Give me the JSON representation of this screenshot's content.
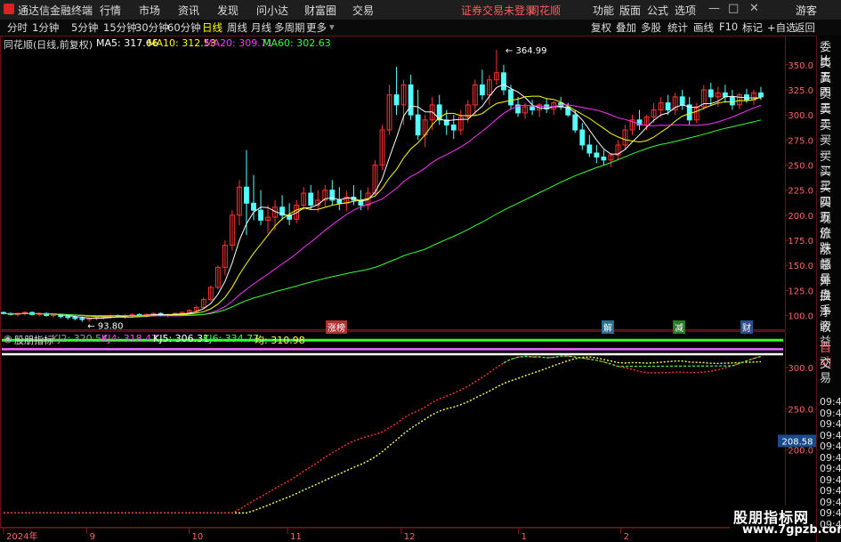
{
  "app": {
    "title": "通达信金融终端"
  },
  "menu": [
    "行情",
    "市场",
    "资讯",
    "发现",
    "问小达",
    "财富圈",
    "交易"
  ],
  "warning": {
    "text": "证券交易未登录",
    "brand": "同花顺"
  },
  "right_menu": [
    "功能",
    "版面",
    "公式",
    "选项"
  ],
  "guest": "游客",
  "toolbar": {
    "periods": [
      "分时",
      "1分钟",
      "5分钟",
      "15分钟",
      "30分钟",
      "60分钟",
      "日线",
      "周线",
      "月线",
      "多周期",
      "更多"
    ],
    "active": "日线",
    "right": [
      "复权",
      "叠加",
      "多股",
      "统计",
      "画线",
      "F10",
      "标记",
      "+自选",
      "返回"
    ]
  },
  "legend_main": {
    "name": "同花顺(日线,前复权)",
    "items": [
      {
        "label": "MA5: 317.66",
        "color": "#ffffff"
      },
      {
        "label": "MA10: 312.53",
        "color": "#ffff00"
      },
      {
        "label": "MA20: 309.71",
        "color": "#ff33ff"
      },
      {
        "label": "MA60: 302.63",
        "color": "#33ff33"
      }
    ]
  },
  "legend_sub": {
    "name": "股朋指标",
    "items": [
      {
        "label": "KJ2: 320.54",
        "color": "#999999"
      },
      {
        "label": "KJ4: 318.47",
        "color": "#ff44ff"
      },
      {
        "label": "KJ5: 306.31",
        "color": "#ffffff"
      },
      {
        "label": "KJ6: 334.77",
        "color": "#33ff33"
      },
      {
        "label": "均: 310.98",
        "color": "#ffff66"
      }
    ]
  },
  "right_panel": {
    "items": [
      "委比",
      "卖五",
      "卖四",
      "卖三",
      "卖二",
      "卖一",
      "买一",
      "买二",
      "买三",
      "买四",
      "买五",
      "现价",
      "涨跌",
      "涨幅",
      "总量",
      "外盘",
      "换手",
      "净资",
      "收益"
    ],
    "auto": "自动",
    "trade": "交易",
    "times": [
      "09:47",
      "09:47",
      "09:47",
      "09:47",
      "09:47",
      "09:47",
      "09:47",
      "09:47",
      "09:47",
      "09:47",
      "09:47",
      "09:47"
    ]
  },
  "markers": [
    {
      "label": "涨榜",
      "color": "#cc3333"
    },
    {
      "label": "解",
      "color": "#3399cc"
    },
    {
      "label": "减",
      "color": "#33aa33"
    },
    {
      "label": "财",
      "color": "#3366cc"
    }
  ],
  "watermark": {
    "line1": "股朋指标网",
    "line2": "www.7gpzb.com"
  },
  "current_value": "208.58",
  "chart_data": [
    {
      "type": "candlestick",
      "title": "同花顺(日线,前复权)",
      "y_ticks": [
        100,
        125,
        150,
        175,
        200,
        225,
        250,
        275,
        300,
        325,
        350
      ],
      "ylim": [
        88,
        372
      ],
      "x_labels": [
        "2024年",
        "9",
        "10",
        "11",
        "12",
        "1",
        "2"
      ],
      "annotations": [
        {
          "text": "364.99"
        },
        {
          "text": "93.80"
        }
      ],
      "candles": [
        [
          103,
          104,
          101,
          102
        ],
        [
          102,
          103,
          100,
          101
        ],
        [
          101,
          103,
          99,
          102
        ],
        [
          102,
          104,
          100,
          103
        ],
        [
          103,
          104,
          100,
          101
        ],
        [
          101,
          103,
          99,
          102
        ],
        [
          102,
          103,
          99,
          100
        ],
        [
          100,
          102,
          98,
          101
        ],
        [
          101,
          102,
          97,
          99
        ],
        [
          99,
          101,
          96,
          98
        ],
        [
          98,
          100,
          95,
          97
        ],
        [
          97,
          99,
          93.8,
          96
        ],
        [
          96,
          98,
          94,
          97
        ],
        [
          97,
          99,
          95,
          98
        ],
        [
          98,
          100,
          96,
          99
        ],
        [
          99,
          101,
          97,
          100
        ],
        [
          100,
          101,
          98,
          99
        ],
        [
          99,
          101,
          97,
          100
        ],
        [
          100,
          102,
          98,
          101
        ],
        [
          101,
          102,
          99,
          100
        ],
        [
          100,
          102,
          98,
          101
        ],
        [
          101,
          103,
          99,
          102
        ],
        [
          102,
          103,
          99,
          100
        ],
        [
          100,
          102,
          98,
          101
        ],
        [
          101,
          103,
          100,
          102
        ],
        [
          102,
          104,
          100,
          103
        ],
        [
          103,
          106,
          101,
          105
        ],
        [
          105,
          110,
          103,
          108
        ],
        [
          108,
          118,
          106,
          116
        ],
        [
          116,
          130,
          114,
          128
        ],
        [
          128,
          150,
          126,
          148
        ],
        [
          148,
          175,
          140,
          170
        ],
        [
          170,
          205,
          165,
          200
        ],
        [
          200,
          235,
          190,
          228
        ],
        [
          228,
          265,
          180,
          212
        ],
        [
          212,
          240,
          195,
          205
        ],
        [
          205,
          225,
          190,
          195
        ],
        [
          195,
          210,
          182,
          198
        ],
        [
          198,
          215,
          185,
          208
        ],
        [
          208,
          220,
          195,
          200
        ],
        [
          200,
          212,
          190,
          196
        ],
        [
          196,
          215,
          192,
          210
        ],
        [
          210,
          228,
          205,
          222
        ],
        [
          222,
          230,
          205,
          210
        ],
        [
          210,
          225,
          203,
          215
        ],
        [
          215,
          230,
          208,
          225
        ],
        [
          225,
          235,
          210,
          215
        ],
        [
          215,
          228,
          205,
          212
        ],
        [
          212,
          224,
          204,
          218
        ],
        [
          218,
          230,
          210,
          215
        ],
        [
          215,
          225,
          205,
          210
        ],
        [
          210,
          228,
          205,
          222
        ],
        [
          222,
          255,
          220,
          250
        ],
        [
          250,
          290,
          245,
          285
        ],
        [
          285,
          330,
          280,
          320
        ],
        [
          320,
          348,
          300,
          310
        ],
        [
          310,
          335,
          290,
          330
        ],
        [
          330,
          340,
          295,
          300
        ],
        [
          300,
          325,
          275,
          280
        ],
        [
          280,
          300,
          268,
          295
        ],
        [
          295,
          318,
          285,
          310
        ],
        [
          310,
          320,
          290,
          295
        ],
        [
          295,
          305,
          280,
          290
        ],
        [
          290,
          300,
          276,
          285
        ],
        [
          285,
          305,
          280,
          298
        ],
        [
          298,
          315,
          292,
          310
        ],
        [
          310,
          335,
          300,
          330
        ],
        [
          330,
          345,
          315,
          320
        ],
        [
          320,
          340,
          310,
          335
        ],
        [
          335,
          365,
          330,
          342
        ],
        [
          342,
          350,
          320,
          325
        ],
        [
          325,
          330,
          305,
          310
        ],
        [
          310,
          318,
          298,
          302
        ],
        [
          302,
          312,
          296,
          308
        ],
        [
          308,
          315,
          300,
          305
        ],
        [
          305,
          312,
          298,
          310
        ],
        [
          310,
          316,
          302,
          306
        ],
        [
          306,
          314,
          300,
          312
        ],
        [
          312,
          318,
          305,
          308
        ],
        [
          308,
          312,
          298,
          300
        ],
        [
          300,
          305,
          282,
          285
        ],
        [
          285,
          292,
          265,
          270
        ],
        [
          270,
          280,
          258,
          262
        ],
        [
          262,
          270,
          252,
          258
        ],
        [
          258,
          265,
          250,
          255
        ],
        [
          255,
          262,
          248,
          260
        ],
        [
          260,
          275,
          255,
          270
        ],
        [
          270,
          290,
          265,
          285
        ],
        [
          285,
          300,
          280,
          295
        ],
        [
          295,
          305,
          285,
          290
        ],
        [
          290,
          300,
          285,
          298
        ],
        [
          298,
          312,
          292,
          305
        ],
        [
          305,
          318,
          298,
          312
        ],
        [
          312,
          320,
          300,
          305
        ],
        [
          305,
          322,
          300,
          318
        ],
        [
          318,
          325,
          305,
          310
        ],
        [
          310,
          318,
          290,
          295
        ],
        [
          295,
          312,
          292,
          308
        ],
        [
          308,
          330,
          305,
          325
        ],
        [
          325,
          332,
          310,
          318
        ],
        [
          318,
          328,
          308,
          322
        ],
        [
          322,
          330,
          312,
          318
        ],
        [
          318,
          325,
          305,
          310
        ],
        [
          310,
          322,
          306,
          320
        ],
        [
          320,
          326,
          312,
          315
        ],
        [
          315,
          325,
          310,
          322
        ],
        [
          322,
          328,
          315,
          318
        ]
      ],
      "series": [
        {
          "name": "MA5",
          "color": "#ffffff"
        },
        {
          "name": "MA10",
          "color": "#ffff00"
        },
        {
          "name": "MA20",
          "color": "#ff33ff"
        },
        {
          "name": "MA60",
          "color": "#33ff33"
        }
      ]
    },
    {
      "type": "line",
      "title": "股朋指标",
      "y_ticks": [
        200,
        250,
        300
      ],
      "ylim": [
        120,
        330
      ],
      "horizontal_bands": [
        {
          "value": 322,
          "color": "#ff66ff"
        },
        {
          "value": 316,
          "color": "#ffffff"
        },
        {
          "value": 333,
          "color": "#33ff33"
        }
      ],
      "series": [
        {
          "name": "KJ4",
          "color": "#ff3333"
        },
        {
          "name": "KJ5",
          "color": "#ffff66"
        }
      ]
    }
  ]
}
